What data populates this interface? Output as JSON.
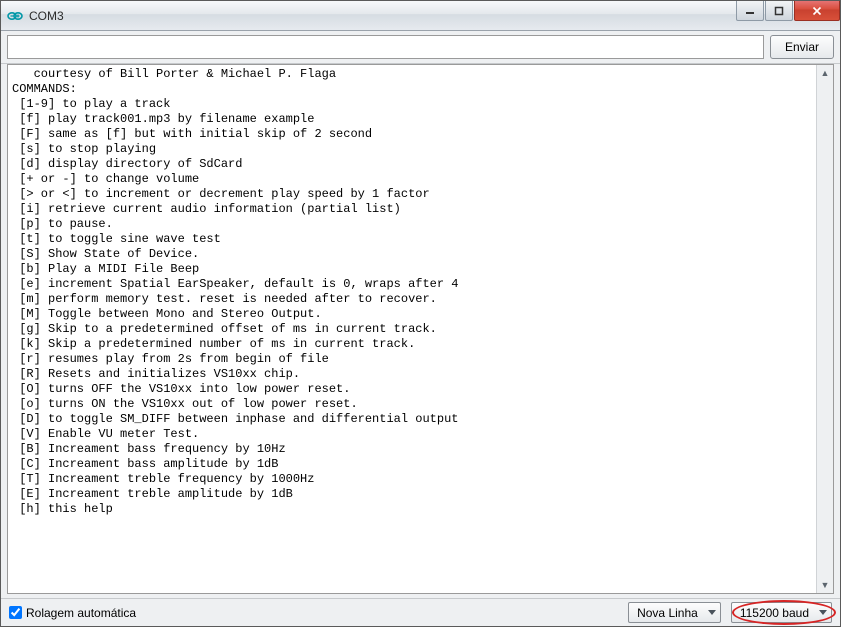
{
  "window": {
    "title": "COM3"
  },
  "toolbar": {
    "input_value": "",
    "input_placeholder": "",
    "send_label": "Enviar"
  },
  "output_lines": [
    "   courtesy of Bill Porter & Michael P. Flaga",
    "COMMANDS:",
    " [1-9] to play a track",
    " [f] play track001.mp3 by filename example",
    " [F] same as [f] but with initial skip of 2 second",
    " [s] to stop playing",
    " [d] display directory of SdCard",
    " [+ or -] to change volume",
    " [> or <] to increment or decrement play speed by 1 factor",
    " [i] retrieve current audio information (partial list)",
    " [p] to pause.",
    " [t] to toggle sine wave test",
    " [S] Show State of Device.",
    " [b] Play a MIDI File Beep",
    " [e] increment Spatial EarSpeaker, default is 0, wraps after 4",
    " [m] perform memory test. reset is needed after to recover.",
    " [M] Toggle between Mono and Stereo Output.",
    " [g] Skip to a predetermined offset of ms in current track.",
    " [k] Skip a predetermined number of ms in current track.",
    " [r] resumes play from 2s from begin of file",
    " [R] Resets and initializes VS10xx chip.",
    " [O] turns OFF the VS10xx into low power reset.",
    " [o] turns ON the VS10xx out of low power reset.",
    " [D] to toggle SM_DIFF between inphase and differential output",
    " [V] Enable VU meter Test.",
    " [B] Increament bass frequency by 10Hz",
    " [C] Increament bass amplitude by 1dB",
    " [T] Increament treble frequency by 1000Hz",
    " [E] Increament treble amplitude by 1dB",
    " [h] this help",
    ""
  ],
  "statusbar": {
    "autoscroll_label": "Rolagem automática",
    "autoscroll_checked": true,
    "line_ending_label": "Nova Linha",
    "baud_label": "115200 baud"
  }
}
